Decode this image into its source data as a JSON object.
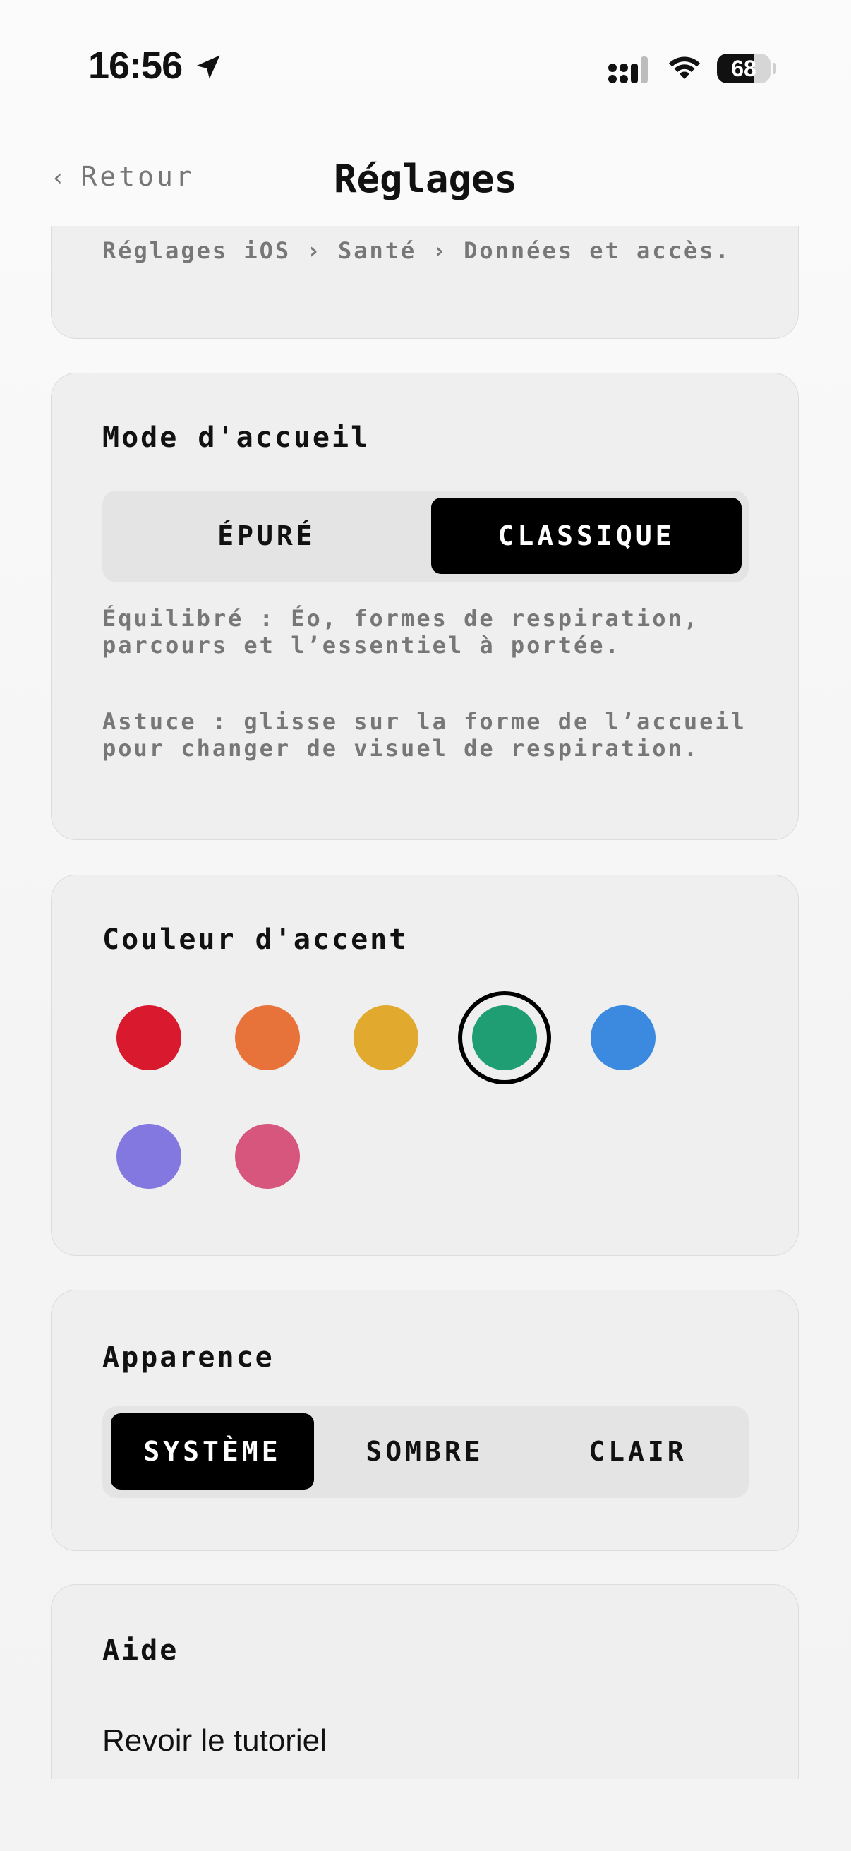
{
  "status_bar": {
    "time": "16:56",
    "location_icon": "location-arrow-icon",
    "signal_icon": "cellular-signal-icon",
    "wifi_icon": "wifi-icon",
    "battery_level": "68",
    "battery_fraction": 0.68
  },
  "nav": {
    "back_label": "Retour",
    "back_icon": "chevron-left-icon",
    "title": "Réglages"
  },
  "health_card": {
    "note": "Réglages iOS › Santé › Données et accès."
  },
  "home_mode": {
    "title": "Mode d'accueil",
    "options": [
      "ÉPURÉ",
      "CLASSIQUE"
    ],
    "selected": "CLASSIQUE",
    "description": "Équilibré : Éo, formes de respiration, parcours et l’essentiel à portée.",
    "tip": "Astuce : glisse sur la forme de l’accueil pour changer de visuel de respiration."
  },
  "accent": {
    "title": "Couleur d'accent",
    "colors": [
      "#d8192e",
      "#e8733a",
      "#e2a92f",
      "#1f9e74",
      "#3b8ae0",
      "#8377e0",
      "#d6567e"
    ],
    "selected_index": 3
  },
  "appearance": {
    "title": "Apparence",
    "options": [
      "SYSTÈME",
      "SOMBRE",
      "CLAIR"
    ],
    "selected": "SYSTÈME"
  },
  "help": {
    "title": "Aide",
    "items": [
      "Revoir le tutoriel"
    ]
  }
}
